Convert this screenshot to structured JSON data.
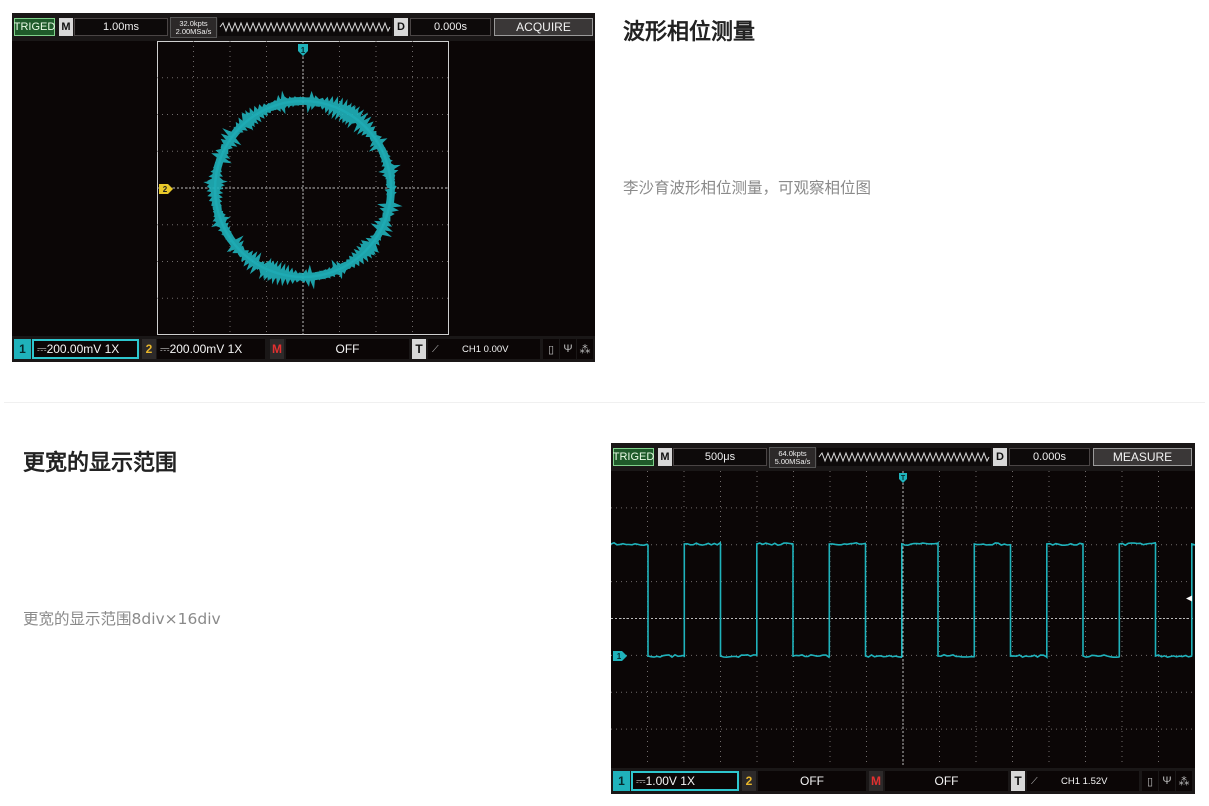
{
  "sections": [
    {
      "heading": "波形相位测量",
      "description": "李沙育波形相位测量，可观察相位图",
      "scope": {
        "trig_status": "TRIGED",
        "mode_badge": "M",
        "timebase": "1.00ms",
        "memory_depth": "32.0kpts",
        "sample_rate": "2.00MSa/s",
        "delay_badge": "D",
        "delay_value": "0.000s",
        "menu_title": "ACQUIRE",
        "ch1_num": "1",
        "ch1_setting": "⎓200.00mV  1X",
        "ch2_num": "2",
        "ch2_setting": "⎓200.00mV  1X",
        "math_badge": "M",
        "math_state": "OFF",
        "trigger_badge": "T",
        "trigger_slope_icon": "rising-edge-icon",
        "trigger_level": "CH1 0.00V",
        "ch1_marker": "1",
        "ch2_marker": "2",
        "trace_color": "#1fb2bb",
        "display_mode": "XY"
      }
    },
    {
      "heading": "更宽的显示范围",
      "description": "更宽的显示范围8div×16div",
      "scope": {
        "trig_status": "TRIGED",
        "mode_badge": "M",
        "timebase": "500μs",
        "memory_depth": "64.0kpts",
        "sample_rate": "5.00MSa/s",
        "delay_badge": "D",
        "delay_value": "0.000s",
        "menu_title": "MEASURE",
        "ch1_num": "1",
        "ch1_setting": "⎓1.00V  1X",
        "ch2_num": "2",
        "ch2_setting": "OFF",
        "math_badge": "M",
        "math_state": "OFF",
        "trigger_badge": "T",
        "trigger_slope_icon": "rising-edge-icon",
        "trigger_level": "CH1 1.52V",
        "ch1_marker": "1",
        "trigger_marker": "T",
        "trace_color": "#1fb2bb",
        "display_mode": "YT",
        "grid_divisions": "8div×16div"
      }
    }
  ]
}
